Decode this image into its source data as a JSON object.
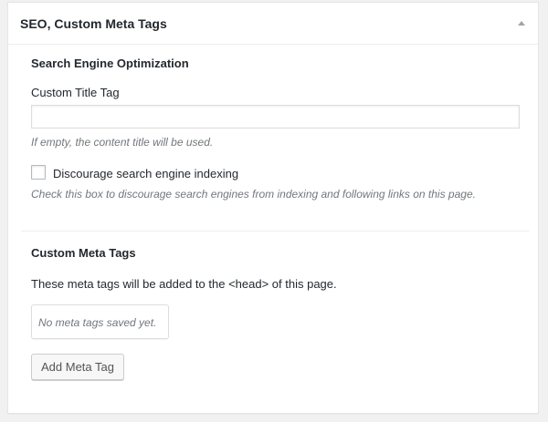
{
  "metabox": {
    "title": "SEO, Custom Meta Tags",
    "toggle_icon": "triangle-up-icon"
  },
  "seo": {
    "heading": "Search Engine Optimization",
    "title_label": "Custom Title Tag",
    "title_value": "",
    "title_placeholder": "",
    "title_hint": "If empty, the content title will be used.",
    "noindex_checked": false,
    "noindex_label": "Discourage search engine indexing",
    "noindex_hint": "Check this box to discourage search engines from indexing and following links on this page."
  },
  "meta_tags": {
    "heading": "Custom Meta Tags",
    "description": "These meta tags will be added to the <head> of this page.",
    "empty_text": "No meta tags saved yet.",
    "add_button_label": "Add Meta Tag"
  },
  "colors": {
    "hint_text": "#72777c",
    "border": "#dddddd",
    "toggle_icon": "#a0a5aa"
  }
}
